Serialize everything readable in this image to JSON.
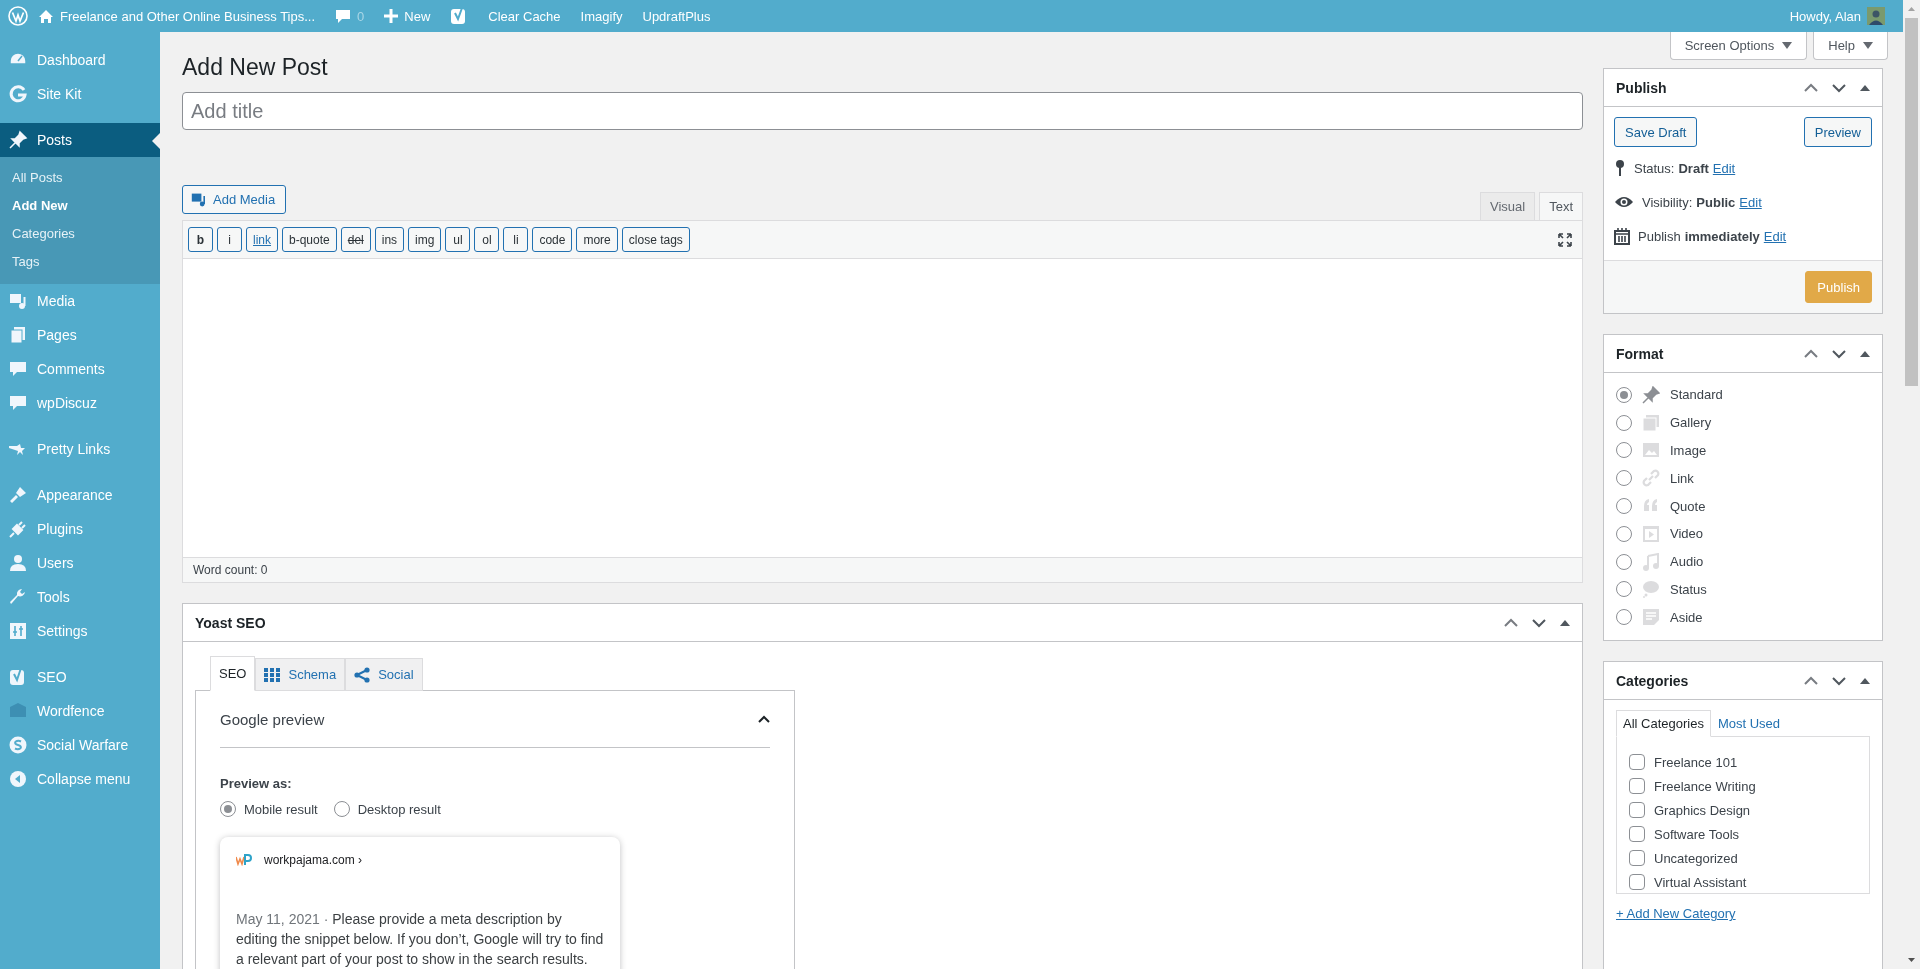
{
  "admin_bar": {
    "site_name": "Freelance and Other Online Business Tips...",
    "comments_count": "0",
    "new_label": "New",
    "plugin_links": [
      "Clear Cache",
      "Imagify",
      "UpdraftPlus"
    ],
    "greeting": "Howdy, Alan"
  },
  "sidebar": {
    "items": [
      {
        "label": "Dashboard",
        "selected": false
      },
      {
        "label": "Site Kit",
        "selected": false
      },
      {
        "label": "Posts",
        "selected": true,
        "children": [
          {
            "label": "All Posts",
            "selected": false
          },
          {
            "label": "Add New",
            "selected": true
          },
          {
            "label": "Categories",
            "selected": false
          },
          {
            "label": "Tags",
            "selected": false
          }
        ]
      },
      {
        "label": "Media",
        "selected": false
      },
      {
        "label": "Pages",
        "selected": false
      },
      {
        "label": "Comments",
        "selected": false
      },
      {
        "label": "wpDiscuz",
        "selected": false
      },
      {
        "label": "Pretty Links",
        "selected": false
      },
      {
        "label": "Appearance",
        "selected": false
      },
      {
        "label": "Plugins",
        "selected": false
      },
      {
        "label": "Users",
        "selected": false
      },
      {
        "label": "Tools",
        "selected": false
      },
      {
        "label": "Settings",
        "selected": false
      },
      {
        "label": "SEO",
        "selected": false
      },
      {
        "label": "Wordfence",
        "selected": false
      },
      {
        "label": "Social Warfare",
        "selected": false
      }
    ],
    "collapse_label": "Collapse menu"
  },
  "screen_meta": [
    "Screen Options",
    "Help"
  ],
  "page_title": "Add New Post",
  "title_field": {
    "placeholder": "Add title"
  },
  "editor": {
    "add_media": "Add Media",
    "tabs": [
      {
        "label": "Visual",
        "selected": false
      },
      {
        "label": "Text",
        "selected": true
      }
    ],
    "quicktags": [
      {
        "label": "b",
        "kind": "bold"
      },
      {
        "label": "i",
        "kind": "italic"
      },
      {
        "label": "link",
        "kind": "underline"
      },
      {
        "label": "b-quote",
        "kind": "plain"
      },
      {
        "label": "del",
        "kind": "strike"
      },
      {
        "label": "ins",
        "kind": "plain"
      },
      {
        "label": "img",
        "kind": "plain"
      },
      {
        "label": "ul",
        "kind": "plain"
      },
      {
        "label": "ol",
        "kind": "plain"
      },
      {
        "label": "li",
        "kind": "plain"
      },
      {
        "label": "code",
        "kind": "plain"
      },
      {
        "label": "more",
        "kind": "plain"
      },
      {
        "label": "close tags",
        "kind": "plain"
      }
    ],
    "word_count": "Word count: 0"
  },
  "publish": {
    "title": "Publish",
    "save_draft": "Save Draft",
    "preview": "Preview",
    "rows": [
      {
        "label": "Status:",
        "value": "Draft",
        "link": "Edit"
      },
      {
        "label": "Visibility:",
        "value": "Public",
        "link": "Edit"
      },
      {
        "label": "Publish",
        "value": "immediately",
        "link": "Edit"
      }
    ],
    "publish_button": "Publish"
  },
  "format": {
    "title": "Format",
    "options": [
      {
        "label": "Standard",
        "selected": true
      },
      {
        "label": "Gallery",
        "selected": false
      },
      {
        "label": "Image",
        "selected": false
      },
      {
        "label": "Link",
        "selected": false
      },
      {
        "label": "Quote",
        "selected": false
      },
      {
        "label": "Video",
        "selected": false
      },
      {
        "label": "Audio",
        "selected": false
      },
      {
        "label": "Status",
        "selected": false
      },
      {
        "label": "Aside",
        "selected": false
      }
    ]
  },
  "categories": {
    "title": "Categories",
    "tabs": [
      {
        "label": "All Categories",
        "selected": true
      },
      {
        "label": "Most Used",
        "selected": false
      }
    ],
    "items": [
      {
        "label": "Freelance 101",
        "checked": false
      },
      {
        "label": "Freelance Writing",
        "checked": false
      },
      {
        "label": "Graphics Design",
        "checked": false
      },
      {
        "label": "Software Tools",
        "checked": false
      },
      {
        "label": "Uncategorized",
        "checked": false
      },
      {
        "label": "Virtual Assistant",
        "checked": false
      }
    ],
    "add_link": "+ Add New Category"
  },
  "yoast": {
    "title": "Yoast SEO",
    "tabs": [
      {
        "label": "SEO",
        "selected": true
      },
      {
        "label": "Schema",
        "selected": false
      },
      {
        "label": "Social",
        "selected": false
      }
    ],
    "google_preview": {
      "title": "Google preview",
      "preview_as": "Preview as:",
      "modes": [
        {
          "label": "Mobile result",
          "selected": true
        },
        {
          "label": "Desktop result",
          "selected": false
        }
      ],
      "url": "workpajama.com ›",
      "date": "May 11, 2021 ·",
      "description": "Please provide a meta description by editing the snippet below. If you don’t, Google will try to find a relevant part of your post to show in the search results."
    }
  }
}
